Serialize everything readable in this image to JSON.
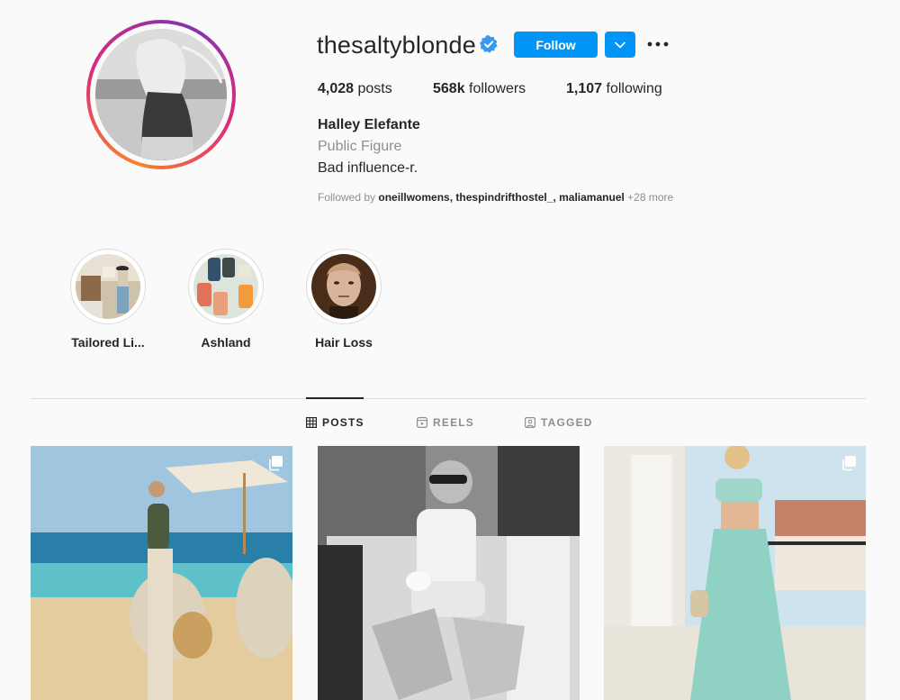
{
  "profile": {
    "username": "thesaltyblonde",
    "verified": true,
    "follow_label": "Follow",
    "stats": [
      {
        "value": "4,028",
        "label": "posts"
      },
      {
        "value": "568k",
        "label": "followers"
      },
      {
        "value": "1,107",
        "label": "following"
      }
    ],
    "full_name": "Halley Elefante",
    "category": "Public Figure",
    "bio": "Bad influence-r.",
    "followed_by": {
      "prefix": "Followed by",
      "accounts": [
        "oneillwomens",
        "thespindrifthostel_",
        "maliamanuel"
      ],
      "more": "+28 more"
    }
  },
  "highlights": [
    {
      "label": "Tailored Li..."
    },
    {
      "label": "Ashland"
    },
    {
      "label": "Hair Loss"
    }
  ],
  "tabs": [
    {
      "label": "POSTS",
      "icon": "grid-icon",
      "active": true
    },
    {
      "label": "REELS",
      "icon": "reels-icon",
      "active": false
    },
    {
      "label": "TAGGED",
      "icon": "tagged-icon",
      "active": false
    }
  ],
  "posts": [
    {
      "icon": "multiple-posts-icon"
    },
    {
      "icon": ""
    },
    {
      "icon": "multiple-posts-icon"
    }
  ],
  "colors": {
    "accent": "#0095f6",
    "text": "#262626",
    "secondary": "#8e8e8e",
    "background": "#fafafa",
    "divider": "#dbdbdb"
  }
}
